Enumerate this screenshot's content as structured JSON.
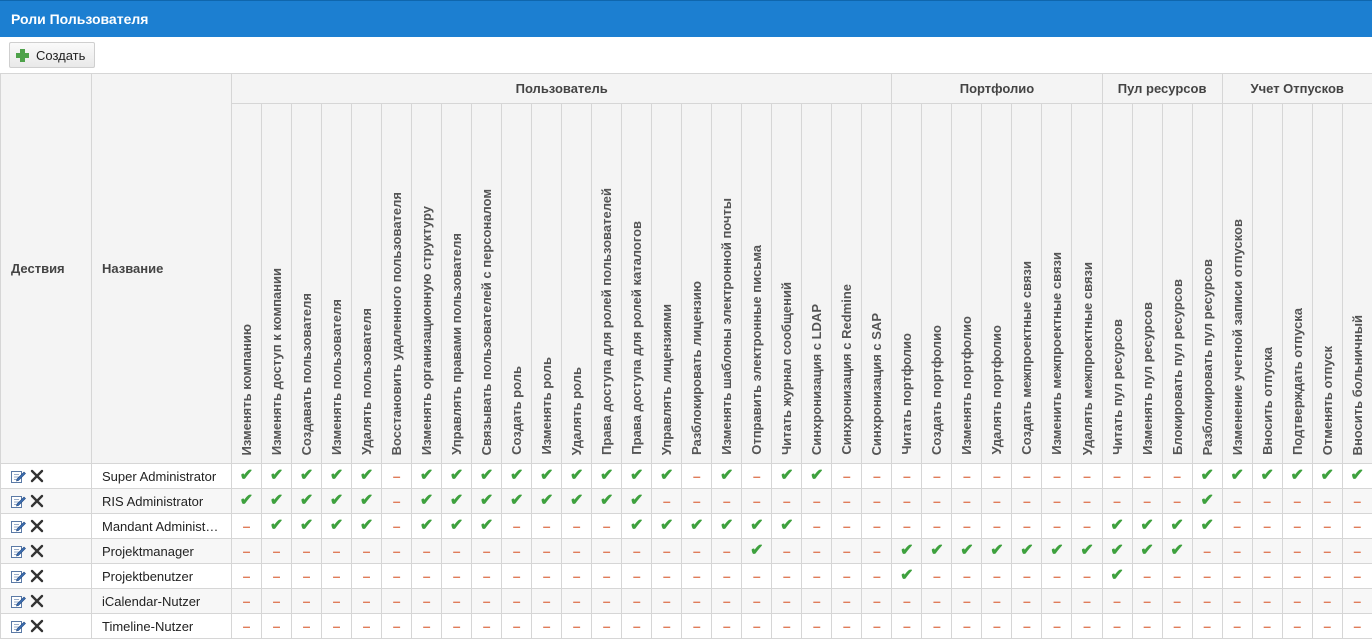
{
  "window": {
    "title": "Роли Пользователя"
  },
  "toolbar": {
    "create_label": "Создать"
  },
  "table": {
    "header_actions": "Дествия",
    "header_name": "Название",
    "groups": [
      {
        "label": "Пользователь",
        "span": 22
      },
      {
        "label": "Портфолио",
        "span": 7
      },
      {
        "label": "Пул ресурсов",
        "span": 4
      },
      {
        "label": "Учет Отпусков",
        "span": 5
      }
    ],
    "columns": [
      "Изменять компанию",
      "Изменять доступ к компании",
      "Создавать пользователя",
      "Изменять пользователя",
      "Удалять пользователя",
      "Восстановить удаленного пользователя",
      "Изменять организационную структуру",
      "Управлять правами пользователя",
      "Связывать пользователей с персоналом",
      "Создать роль",
      "Изменять роль",
      "Удалять роль",
      "Права доступа для ролей пользователей",
      "Права доступа для ролей каталогов",
      "Управлять лицензиями",
      "Разблокировать лицензию",
      "Изменять шаблоны электронной почты",
      "Отправить электронные письма",
      "Читать журнал сообщений",
      "Синхронизация с LDAP",
      "Синхронизация с Redmine",
      "Синхронизация с SAP",
      "Читать портфолио",
      "Создать портфолио",
      "Изменять портфолио",
      "Удалять портфолио",
      "Создать межпроектные связи",
      "Изменить межпроектные связи",
      "Удалять межпроектные связи",
      "Читать пул ресурсов",
      "Изменять пул ресурсов",
      "Блокировать пул ресурсов",
      "Разблокировать пул ресурсов",
      "Изменение учетной записи отпусков",
      "Вносить отпуска",
      "Подтверждать отпуска",
      "Отменять отпуск",
      "Вносить больничный"
    ],
    "check_symbol": "✔",
    "dash_symbol": "–",
    "rows": [
      {
        "name": "Super Administrator",
        "values": [
          1,
          1,
          1,
          1,
          1,
          0,
          1,
          1,
          1,
          1,
          1,
          1,
          1,
          1,
          1,
          0,
          1,
          0,
          1,
          1,
          0,
          0,
          0,
          0,
          0,
          0,
          0,
          0,
          0,
          0,
          0,
          0,
          1,
          1,
          1,
          1,
          1,
          1
        ]
      },
      {
        "name": "RIS Administrator",
        "values": [
          1,
          1,
          1,
          1,
          1,
          0,
          1,
          1,
          1,
          1,
          1,
          1,
          1,
          1,
          0,
          0,
          0,
          0,
          0,
          0,
          0,
          0,
          0,
          0,
          0,
          0,
          0,
          0,
          0,
          0,
          0,
          0,
          1,
          0,
          0,
          0,
          0,
          0
        ]
      },
      {
        "name": "Mandant Administ…",
        "values": [
          0,
          1,
          1,
          1,
          1,
          0,
          1,
          1,
          1,
          0,
          0,
          0,
          0,
          1,
          1,
          1,
          1,
          1,
          1,
          0,
          0,
          0,
          0,
          0,
          0,
          0,
          0,
          0,
          0,
          1,
          1,
          1,
          1,
          0,
          0,
          0,
          0,
          0
        ]
      },
      {
        "name": "Projektmanager",
        "values": [
          0,
          0,
          0,
          0,
          0,
          0,
          0,
          0,
          0,
          0,
          0,
          0,
          0,
          0,
          0,
          0,
          0,
          1,
          0,
          0,
          0,
          0,
          1,
          1,
          1,
          1,
          1,
          1,
          1,
          1,
          1,
          1,
          0,
          0,
          0,
          0,
          0,
          0
        ]
      },
      {
        "name": "Projektbenutzer",
        "values": [
          0,
          0,
          0,
          0,
          0,
          0,
          0,
          0,
          0,
          0,
          0,
          0,
          0,
          0,
          0,
          0,
          0,
          0,
          0,
          0,
          0,
          0,
          1,
          0,
          0,
          0,
          0,
          0,
          0,
          1,
          0,
          0,
          0,
          0,
          0,
          0,
          0,
          0
        ]
      },
      {
        "name": "iCalendar-Nutzer",
        "values": [
          0,
          0,
          0,
          0,
          0,
          0,
          0,
          0,
          0,
          0,
          0,
          0,
          0,
          0,
          0,
          0,
          0,
          0,
          0,
          0,
          0,
          0,
          0,
          0,
          0,
          0,
          0,
          0,
          0,
          0,
          0,
          0,
          0,
          0,
          0,
          0,
          0,
          0
        ]
      },
      {
        "name": "Timeline-Nutzer",
        "values": [
          0,
          0,
          0,
          0,
          0,
          0,
          0,
          0,
          0,
          0,
          0,
          0,
          0,
          0,
          0,
          0,
          0,
          0,
          0,
          0,
          0,
          0,
          0,
          0,
          0,
          0,
          0,
          0,
          0,
          0,
          0,
          0,
          0,
          0,
          0,
          0,
          0,
          0
        ]
      }
    ]
  },
  "colors": {
    "titlebar": "#1c7fd1",
    "check": "#3ea13e",
    "dash": "#e07c5a"
  }
}
